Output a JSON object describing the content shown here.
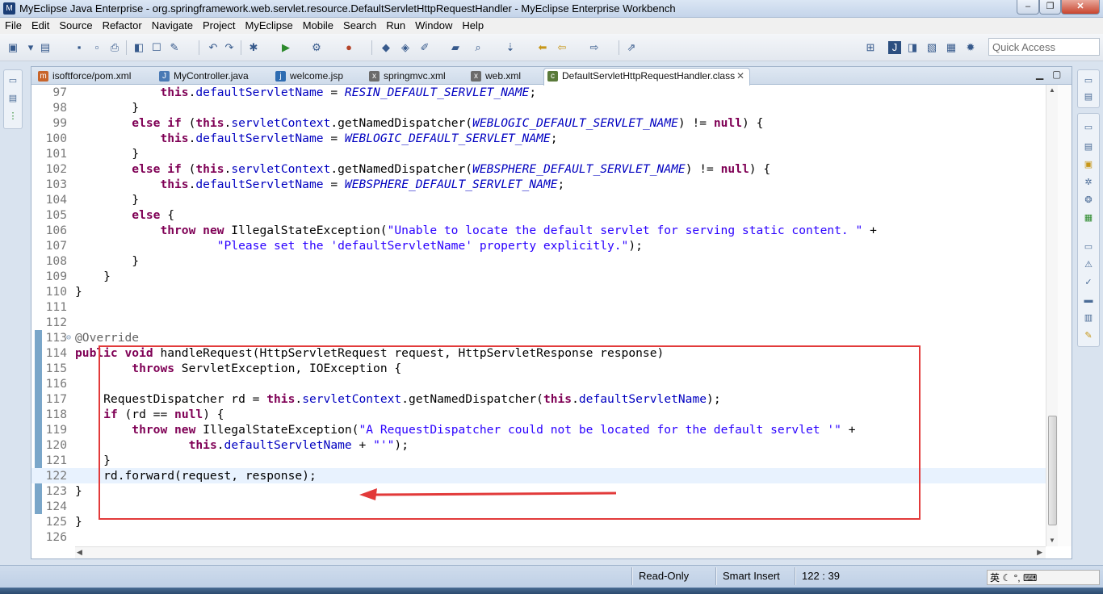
{
  "window": {
    "title": "MyEclipse Java Enterprise - org.springframework.web.servlet.resource.DefaultServletHttpRequestHandler - MyEclipse Enterprise Workbench",
    "buttons": {
      "minimize": "‒",
      "maximize": "❐",
      "close": "✕"
    }
  },
  "menu": [
    "File",
    "Edit",
    "Source",
    "Refactor",
    "Navigate",
    "Project",
    "MyEclipse",
    "Mobile",
    "Search",
    "Run",
    "Window",
    "Help"
  ],
  "toolbar": {
    "quick_access_placeholder": "Quick Access"
  },
  "tabs": [
    {
      "label": "isoftforce/pom.xml",
      "icon": "maven-pom-icon",
      "color": "#c8642a"
    },
    {
      "label": "MyController.java",
      "icon": "java-file-icon",
      "color": "#4a7ab5"
    },
    {
      "label": "welcome.jsp",
      "icon": "jsp-file-icon",
      "color": "#2e6cb2"
    },
    {
      "label": "springmvc.xml",
      "icon": "xml-file-icon",
      "color": "#6b6b6b"
    },
    {
      "label": "web.xml",
      "icon": "xml-file-icon",
      "color": "#6b6b6b"
    },
    {
      "label": "DefaultServletHttpRequestHandler.class",
      "icon": "class-file-icon",
      "color": "#5a7a3a",
      "active": true,
      "close": "✕"
    }
  ],
  "code_lines": [
    {
      "n": "97",
      "html": "            <span class=\"kw\">this</span>.<span class=\"fld\">defaultServletName</span> = <span class=\"cst\">RESIN_DEFAULT_SERVLET_NAME</span>;"
    },
    {
      "n": "98",
      "html": "        }"
    },
    {
      "n": "99",
      "html": "        <span class=\"kw\">else if</span> (<span class=\"kw\">this</span>.<span class=\"fld\">servletContext</span>.getNamedDispatcher(<span class=\"cst\">WEBLOGIC_DEFAULT_SERVLET_NAME</span>) != <span class=\"kw\">null</span>) {"
    },
    {
      "n": "100",
      "html": "            <span class=\"kw\">this</span>.<span class=\"fld\">defaultServletName</span> = <span class=\"cst\">WEBLOGIC_DEFAULT_SERVLET_NAME</span>;"
    },
    {
      "n": "101",
      "html": "        }"
    },
    {
      "n": "102",
      "html": "        <span class=\"kw\">else if</span> (<span class=\"kw\">this</span>.<span class=\"fld\">servletContext</span>.getNamedDispatcher(<span class=\"cst\">WEBSPHERE_DEFAULT_SERVLET_NAME</span>) != <span class=\"kw\">null</span>) {"
    },
    {
      "n": "103",
      "html": "            <span class=\"kw\">this</span>.<span class=\"fld\">defaultServletName</span> = <span class=\"cst\">WEBSPHERE_DEFAULT_SERVLET_NAME</span>;"
    },
    {
      "n": "104",
      "html": "        }"
    },
    {
      "n": "105",
      "html": "        <span class=\"kw\">else</span> {"
    },
    {
      "n": "106",
      "html": "            <span class=\"kw\">throw new</span> IllegalStateException(<span class=\"str\">\"Unable to locate the default servlet for serving static content. \"</span> +"
    },
    {
      "n": "107",
      "html": "                    <span class=\"str\">\"Please set the 'defaultServletName' property explicitly.\"</span>);"
    },
    {
      "n": "108",
      "html": "        }"
    },
    {
      "n": "109",
      "html": "    }"
    },
    {
      "n": "110",
      "html": "}"
    },
    {
      "n": "111",
      "html": ""
    },
    {
      "n": "112",
      "html": ""
    },
    {
      "n": "113",
      "html": "<span class=\"ann\">@Override</span>",
      "fold": "⊖"
    },
    {
      "n": "114",
      "html": "<span class=\"kw\">public void</span> handleRequest(HttpServletRequest request, HttpServletResponse response)"
    },
    {
      "n": "115",
      "html": "        <span class=\"kw\">throws</span> ServletException, IOException {"
    },
    {
      "n": "116",
      "html": ""
    },
    {
      "n": "117",
      "html": "    RequestDispatcher rd = <span class=\"kw\">this</span>.<span class=\"fld\">servletContext</span>.getNamedDispatcher(<span class=\"kw\">this</span>.<span class=\"fld\">defaultServletName</span>);"
    },
    {
      "n": "118",
      "html": "    <span class=\"kw\">if</span> (rd == <span class=\"kw\">null</span>) {"
    },
    {
      "n": "119",
      "html": "        <span class=\"kw\">throw new</span> IllegalStateException(<span class=\"str\">\"A RequestDispatcher could not be located for the default servlet '\"</span> +"
    },
    {
      "n": "120",
      "html": "                <span class=\"kw\">this</span>.<span class=\"fld\">defaultServletName</span> + <span class=\"str\">\"'\"</span>);"
    },
    {
      "n": "121",
      "html": "    }"
    },
    {
      "n": "122",
      "html": "    rd.forward(request, response);",
      "current": true
    },
    {
      "n": "123",
      "html": "}"
    },
    {
      "n": "124",
      "html": ""
    },
    {
      "n": "125",
      "html": "}"
    },
    {
      "n": "126",
      "html": ""
    }
  ],
  "status": {
    "mode": "Read-Only",
    "insert": "Smart Insert",
    "position": "122 : 39",
    "ime": "英"
  },
  "colors": {
    "annotation_box": "#e23a3a",
    "arrow": "#e23a3a"
  }
}
